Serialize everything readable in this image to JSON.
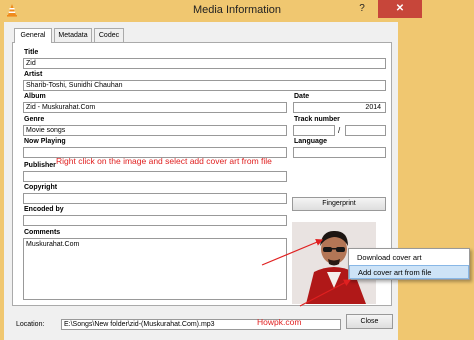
{
  "window": {
    "title": "Media Information",
    "help_glyph": "?",
    "close_glyph": "✕"
  },
  "tabs": [
    {
      "label": "General"
    },
    {
      "label": "Metadata"
    },
    {
      "label": "Codec"
    }
  ],
  "fields": {
    "title_label": "Title",
    "title_value": "Zid",
    "artist_label": "Artist",
    "artist_value": "Sharib-Toshi, Sunidhi Chauhan",
    "album_label": "Album",
    "album_value": "Zid - Muskurahat.Com",
    "date_label": "Date",
    "date_value": "2014",
    "genre_label": "Genre",
    "genre_value": "Movie songs",
    "track_label": "Track number",
    "track_value": "",
    "track_sep": "/",
    "track_total": "",
    "now_playing_label": "Now Playing",
    "now_playing_value": "",
    "language_label": "Language",
    "language_value": "",
    "publisher_label": "Publisher",
    "copyright_label": "Copyright",
    "copyright_value": "",
    "encoded_label": "Encoded by",
    "encoded_value": "",
    "comments_label": "Comments",
    "comments_value": "Muskurahat.Com"
  },
  "buttons": {
    "fingerprint": "Fingerprint",
    "close": "Close"
  },
  "location": {
    "label": "Location:",
    "value": "E:\\Songs\\New folder\\zid-(Muskurahat.Com).mp3"
  },
  "context_menu": {
    "items": [
      {
        "label": "Download cover art"
      },
      {
        "label": "Add cover art from file"
      }
    ]
  },
  "annotations": {
    "instruction": "Right click on the image and select add cover art from file",
    "watermark": "Howpk.com"
  },
  "colors": {
    "frame": "#f0c770",
    "close_button": "#c7463a",
    "annotation": "#e02020",
    "menu_highlight": "#cde3f7"
  }
}
